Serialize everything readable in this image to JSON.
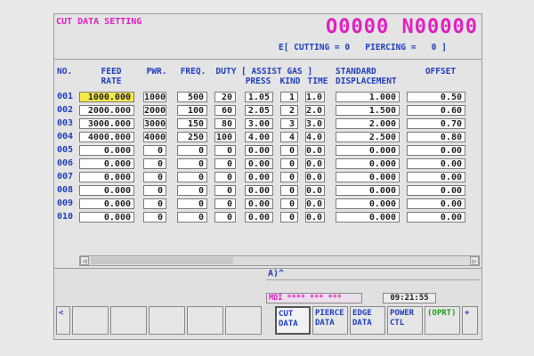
{
  "screen_title": "CUT DATA SETTING",
  "program_number": "O0000 N00000",
  "status": {
    "cutting_label": "E[ CUTTING =",
    "cutting_value": "0",
    "piercing_label": "PIERCING =",
    "piercing_value": "0 ]"
  },
  "headers": {
    "no": "NO.",
    "feed": "FEED\nRATE",
    "pwr": "PWR.",
    "freq": "FREQ.",
    "duty": "DUTY",
    "assist": "[ ASSIST GAS ]",
    "press": "PRESS",
    "kind": "KIND",
    "time": "TIME",
    "standard": "STANDARD\nDISPLACEMENT",
    "offset": "OFFSET"
  },
  "rows": [
    {
      "no": "001",
      "feed": "1000.000",
      "pwr": "1000",
      "freq": "500",
      "duty": "20",
      "press": "1.05",
      "kind": "1",
      "time": "1.0",
      "disp": "1.000",
      "offset": "0.50"
    },
    {
      "no": "002",
      "feed": "2000.000",
      "pwr": "2000",
      "freq": "100",
      "duty": "60",
      "press": "2.05",
      "kind": "2",
      "time": "2.0",
      "disp": "1.500",
      "offset": "0.60"
    },
    {
      "no": "003",
      "feed": "3000.000",
      "pwr": "3000",
      "freq": "150",
      "duty": "80",
      "press": "3.00",
      "kind": "3",
      "time": "3.0",
      "disp": "2.000",
      "offset": "0.70"
    },
    {
      "no": "004",
      "feed": "4000.000",
      "pwr": "4000",
      "freq": "250",
      "duty": "100",
      "press": "4.00",
      "kind": "4",
      "time": "4.0",
      "disp": "2.500",
      "offset": "0.80"
    },
    {
      "no": "005",
      "feed": "0.000",
      "pwr": "0",
      "freq": "0",
      "duty": "0",
      "press": "0.00",
      "kind": "0",
      "time": "0.0",
      "disp": "0.000",
      "offset": "0.00"
    },
    {
      "no": "006",
      "feed": "0.000",
      "pwr": "0",
      "freq": "0",
      "duty": "0",
      "press": "0.00",
      "kind": "0",
      "time": "0.0",
      "disp": "0.000",
      "offset": "0.00"
    },
    {
      "no": "007",
      "feed": "0.000",
      "pwr": "0",
      "freq": "0",
      "duty": "0",
      "press": "0.00",
      "kind": "0",
      "time": "0.0",
      "disp": "0.000",
      "offset": "0.00"
    },
    {
      "no": "008",
      "feed": "0.000",
      "pwr": "0",
      "freq": "0",
      "duty": "0",
      "press": "0.00",
      "kind": "0",
      "time": "0.0",
      "disp": "0.000",
      "offset": "0.00"
    },
    {
      "no": "009",
      "feed": "0.000",
      "pwr": "0",
      "freq": "0",
      "duty": "0",
      "press": "0.00",
      "kind": "0",
      "time": "0.0",
      "disp": "0.000",
      "offset": "0.00"
    },
    {
      "no": "010",
      "feed": "0.000",
      "pwr": "0",
      "freq": "0",
      "duty": "0",
      "press": "0.00",
      "kind": "0",
      "time": "0.0",
      "disp": "0.000",
      "offset": "0.00"
    }
  ],
  "prompt": "A)^",
  "mode": "MDI **** *** ***",
  "clock": "09:21:55",
  "softkeys": {
    "left_arrow": "<",
    "right_plus": "+",
    "cut": "CUT\nDATA",
    "pierce": "PIERCE\nDATA",
    "edge": "EDGE\nDATA",
    "power": "POWER\nCTL",
    "oprt": "(OPRT)"
  },
  "scroll_arrows": {
    "left": "◁",
    "right": "▷"
  }
}
